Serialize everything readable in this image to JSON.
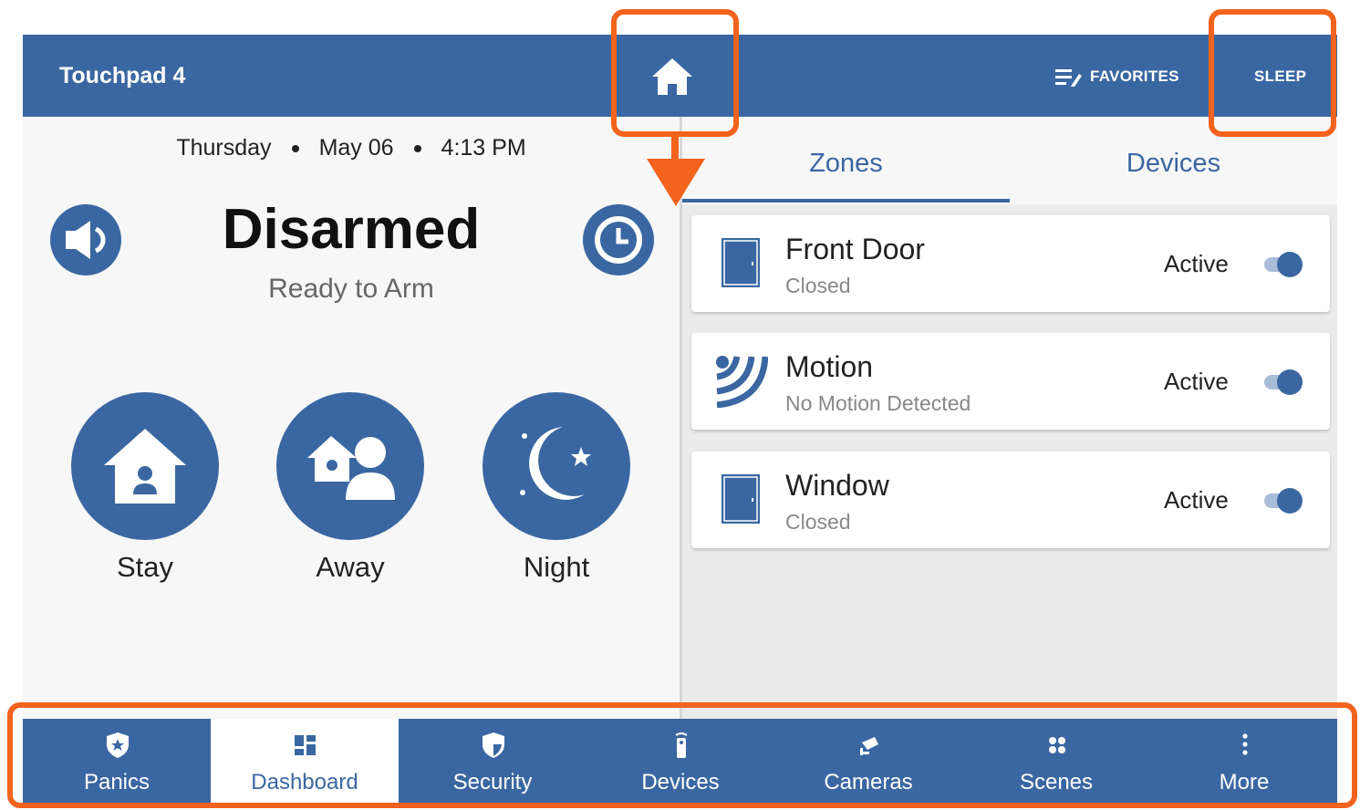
{
  "header": {
    "title": "Touchpad 4",
    "home_icon": "home-icon",
    "favorites_label": "FAVORITES",
    "sleep_label": "SLEEP"
  },
  "dashboard": {
    "day": "Thursday",
    "date": "May 06",
    "time": "4:13 PM",
    "status": "Disarmed",
    "status_detail": "Ready to Arm",
    "arm_modes": [
      {
        "label": "Stay",
        "icon": "stay-house-icon"
      },
      {
        "label": "Away",
        "icon": "away-people-icon"
      },
      {
        "label": "Night",
        "icon": "night-moon-icon"
      }
    ]
  },
  "tabs": [
    {
      "label": "Zones",
      "selected": true
    },
    {
      "label": "Devices",
      "selected": false
    }
  ],
  "zones": [
    {
      "name": "Front Door",
      "state": "Closed",
      "status": "Active",
      "icon": "door-icon",
      "enabled": true
    },
    {
      "name": "Motion",
      "state": "No Motion Detected",
      "status": "Active",
      "icon": "motion-sensor-icon",
      "enabled": true
    },
    {
      "name": "Window",
      "state": "Closed",
      "status": "Active",
      "icon": "window-icon",
      "enabled": true
    }
  ],
  "bottom_nav": [
    {
      "label": "Panics",
      "icon": "panic-shield-icon",
      "active": false
    },
    {
      "label": "Dashboard",
      "icon": "dashboard-grid-icon",
      "active": true
    },
    {
      "label": "Security",
      "icon": "security-shield-icon",
      "active": false
    },
    {
      "label": "Devices",
      "icon": "devices-remote-icon",
      "active": false
    },
    {
      "label": "Cameras",
      "icon": "camera-icon",
      "active": false
    },
    {
      "label": "Scenes",
      "icon": "scenes-icon",
      "active": false
    },
    {
      "label": "More",
      "icon": "more-vertical-icon",
      "active": false
    }
  ],
  "colors": {
    "brand": "#3a67a1",
    "highlight": "#f3631d",
    "panel": "#f7f7f8",
    "list_bg": "#ebebeb"
  }
}
